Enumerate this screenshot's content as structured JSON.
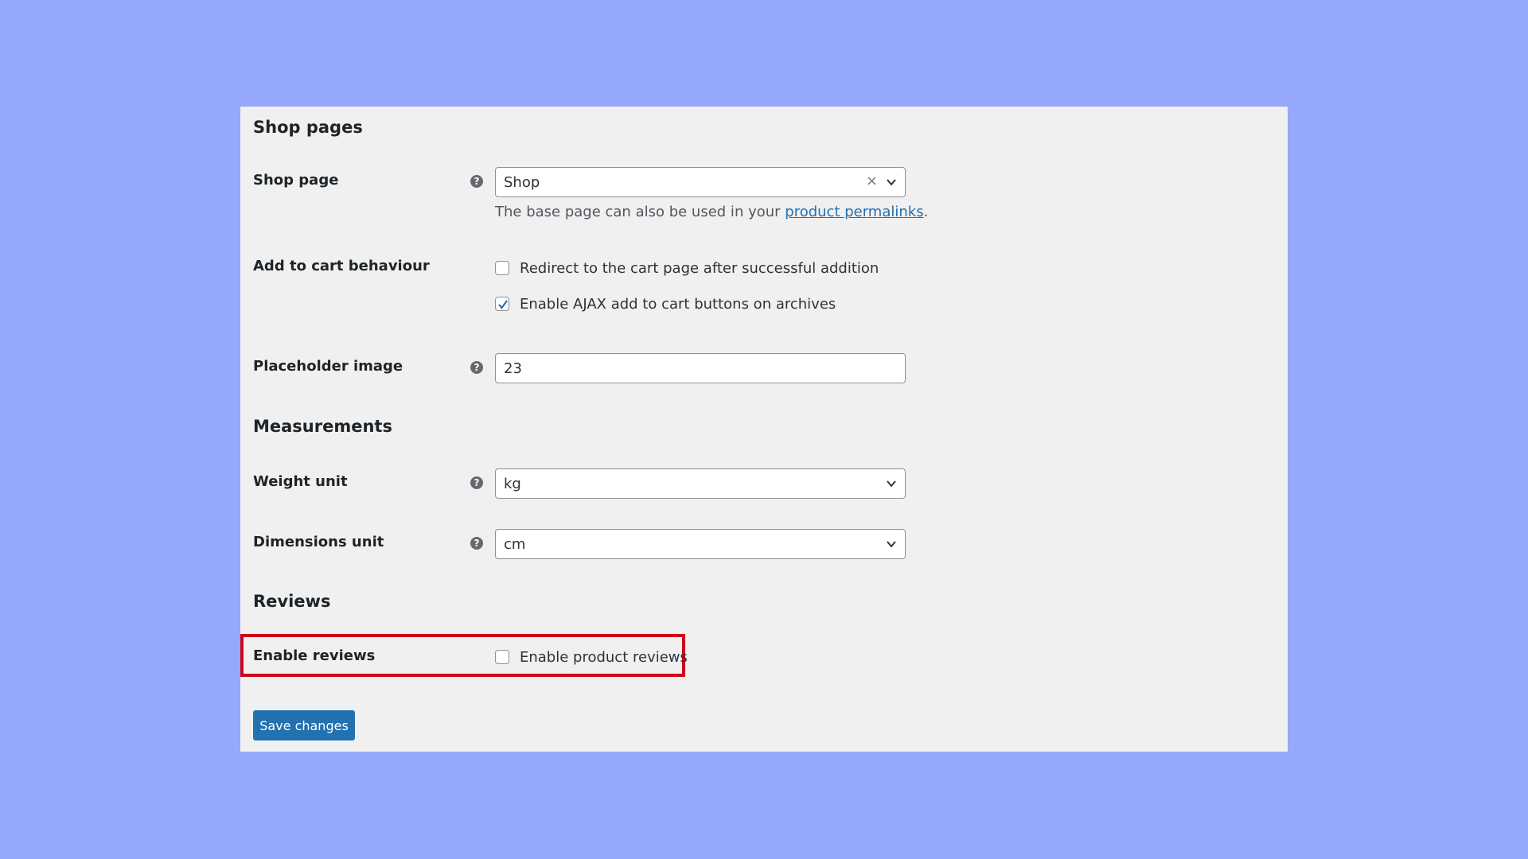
{
  "sections": {
    "shop_pages": "Shop pages",
    "measurements": "Measurements",
    "reviews": "Reviews"
  },
  "shop_page": {
    "label": "Shop page",
    "value": "Shop",
    "clear": "×",
    "description": "The base page can also be used in your ",
    "link": "product permalinks",
    "description_end": "."
  },
  "add_to_cart": {
    "label": "Add to cart behaviour",
    "redirect_label": "Redirect to the cart page after successful addition",
    "redirect_checked": false,
    "ajax_label": "Enable AJAX add to cart buttons on archives",
    "ajax_checked": true
  },
  "placeholder_image": {
    "label": "Placeholder image",
    "value": "23"
  },
  "weight_unit": {
    "label": "Weight unit",
    "value": "kg"
  },
  "dimensions_unit": {
    "label": "Dimensions unit",
    "value": "cm"
  },
  "enable_reviews": {
    "label": "Enable reviews",
    "checkbox_label": "Enable product reviews",
    "checked": false
  },
  "save_button": "Save changes",
  "colors": {
    "background": "#95a8f9",
    "panel": "#f0f0f1",
    "primary": "#2271b1",
    "highlight": "#d0021b"
  }
}
